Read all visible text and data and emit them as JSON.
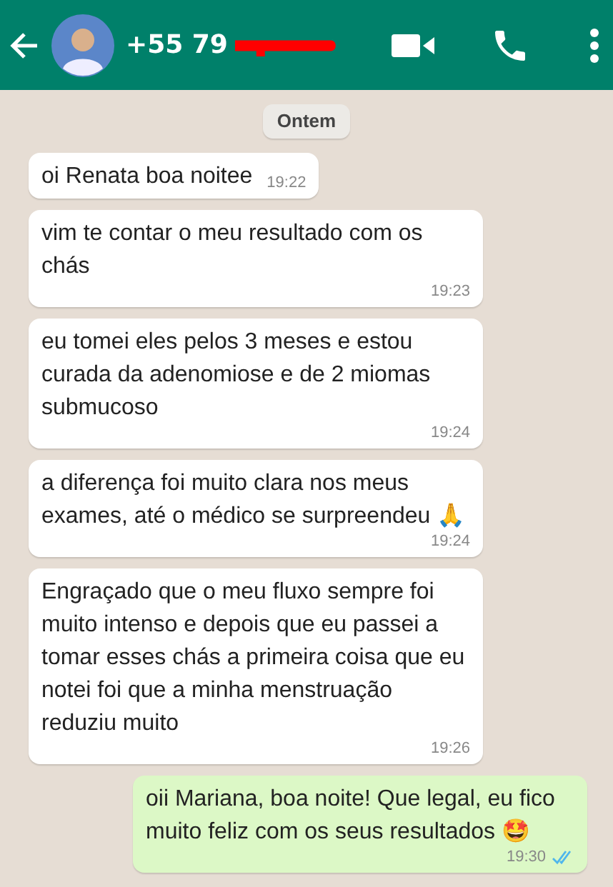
{
  "header": {
    "title": "+55 79",
    "redacted": true
  },
  "date_chip": "Ontem",
  "messages": [
    {
      "kind": "incoming",
      "text": "oi Renata boa noitee",
      "time": "19:22"
    },
    {
      "kind": "incoming",
      "text": "vim te contar o meu resultado com os chás",
      "time": "19:23"
    },
    {
      "kind": "incoming",
      "text": "eu tomei eles pelos 3 meses e estou curada da adenomiose e de 2 miomas submucoso",
      "time": "19:24"
    },
    {
      "kind": "incoming",
      "text": "a diferença foi muito clara nos meus exames, até o médico se surpreendeu 🙏",
      "time": "19:24"
    },
    {
      "kind": "incoming",
      "text": "Engraçado que o meu fluxo sempre foi muito intenso e depois que eu passei a tomar esses chás a primeira coisa que eu notei foi que a minha menstruação reduziu muito",
      "time": "19:26"
    },
    {
      "kind": "outgoing",
      "text": "oii Mariana, boa noite! Que legal, eu fico muito feliz com os seus resultados 🤩",
      "time": "19:30",
      "read": true
    }
  ]
}
